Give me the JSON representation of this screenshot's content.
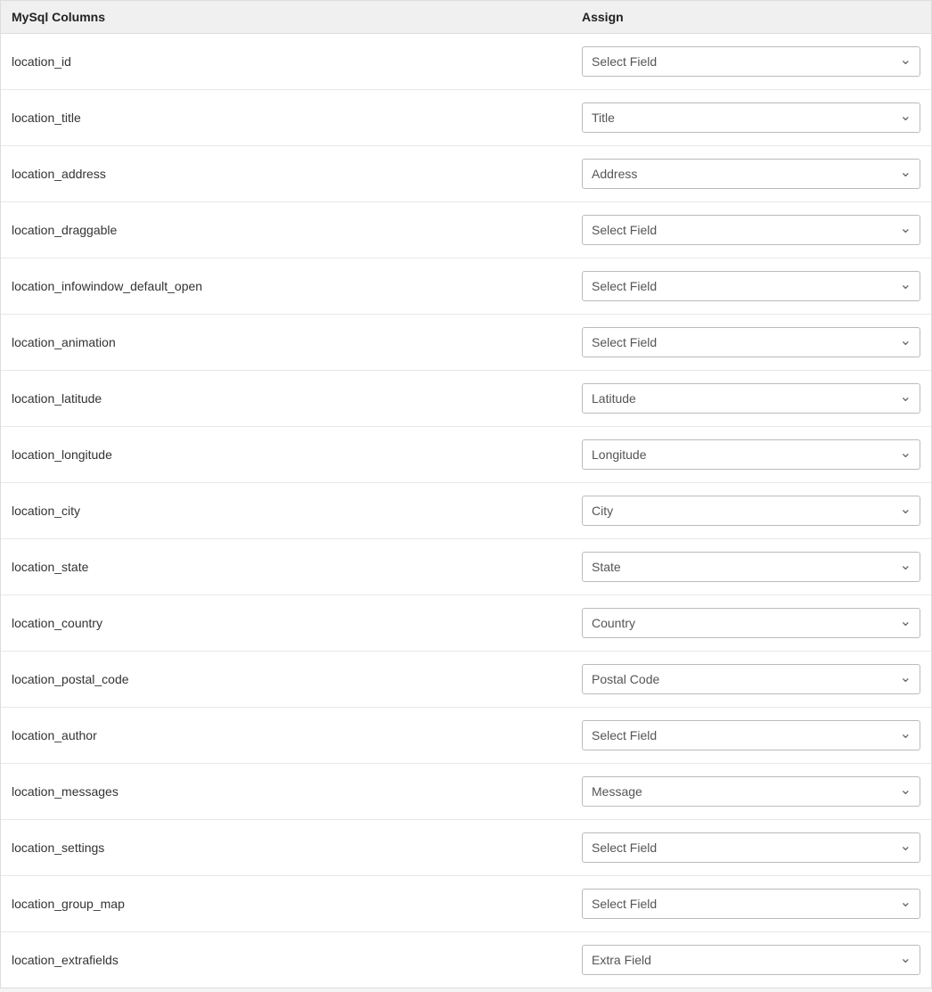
{
  "header": {
    "mysql_columns_label": "MySql Columns",
    "assign_label": "Assign"
  },
  "rows": [
    {
      "id": "location_id",
      "column": "location_id",
      "selected": "select_field",
      "value": "Select Field"
    },
    {
      "id": "location_title",
      "column": "location_title",
      "selected": "title",
      "value": "Title"
    },
    {
      "id": "location_address",
      "column": "location_address",
      "selected": "address",
      "value": "Address"
    },
    {
      "id": "location_draggable",
      "column": "location_draggable",
      "selected": "select_field",
      "value": "Select Field"
    },
    {
      "id": "location_infowindow_default_open",
      "column": "location_infowindow_default_open",
      "selected": "select_field",
      "value": "Select Field"
    },
    {
      "id": "location_animation",
      "column": "location_animation",
      "selected": "select_field",
      "value": "Select Field"
    },
    {
      "id": "location_latitude",
      "column": "location_latitude",
      "selected": "latitude",
      "value": "Latitude"
    },
    {
      "id": "location_longitude",
      "column": "location_longitude",
      "selected": "longitude",
      "value": "Longitude"
    },
    {
      "id": "location_city",
      "column": "location_city",
      "selected": "city",
      "value": "City"
    },
    {
      "id": "location_state",
      "column": "location_state",
      "selected": "state",
      "value": "State"
    },
    {
      "id": "location_country",
      "column": "location_country",
      "selected": "country",
      "value": "Country"
    },
    {
      "id": "location_postal_code",
      "column": "location_postal_code",
      "selected": "postal_code",
      "value": "Postal Code"
    },
    {
      "id": "location_author",
      "column": "location_author",
      "selected": "select_field",
      "value": "Select Field"
    },
    {
      "id": "location_messages",
      "column": "location_messages",
      "selected": "message",
      "value": "Message"
    },
    {
      "id": "location_settings",
      "column": "location_settings",
      "selected": "select_field",
      "value": "Select Field"
    },
    {
      "id": "location_group_map",
      "column": "location_group_map",
      "selected": "select_field",
      "value": "Select Field"
    },
    {
      "id": "location_extrafields",
      "column": "location_extrafields",
      "selected": "extra_field",
      "value": "Extra Field"
    }
  ],
  "select_options": [
    {
      "value": "select_field",
      "label": "Select Field"
    },
    {
      "value": "title",
      "label": "Title"
    },
    {
      "value": "address",
      "label": "Address"
    },
    {
      "value": "latitude",
      "label": "Latitude"
    },
    {
      "value": "longitude",
      "label": "Longitude"
    },
    {
      "value": "city",
      "label": "City"
    },
    {
      "value": "state",
      "label": "State"
    },
    {
      "value": "country",
      "label": "Country"
    },
    {
      "value": "postal_code",
      "label": "Postal Code"
    },
    {
      "value": "message",
      "label": "Message"
    },
    {
      "value": "extra_field",
      "label": "Extra Field"
    }
  ]
}
